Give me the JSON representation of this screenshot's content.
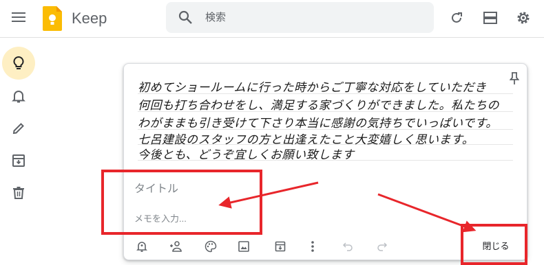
{
  "header": {
    "app_name": "Keep",
    "search_placeholder": "検索"
  },
  "note": {
    "handwritten_lines": [
      "初めてショールームに行った時からご丁寧な対応をしていただき",
      "何回も打ち合わせをし、満足する家づくりができました。私たちの",
      "わがままも引き受けて下さり本当に感謝の気持ちでいっぱいです。",
      "七呂建設のスタッフの方と出逢えたこと大変嬉しく思います。",
      "今後とも、どうぞ宜しくお願い致します"
    ],
    "title_placeholder": "タイトル",
    "body_placeholder": "メモを入力...",
    "close_label": "閉じる"
  },
  "colors": {
    "accent_red": "#e8262b",
    "active_nav": "#feefc3",
    "keep_yellow": "#fbbc04"
  }
}
